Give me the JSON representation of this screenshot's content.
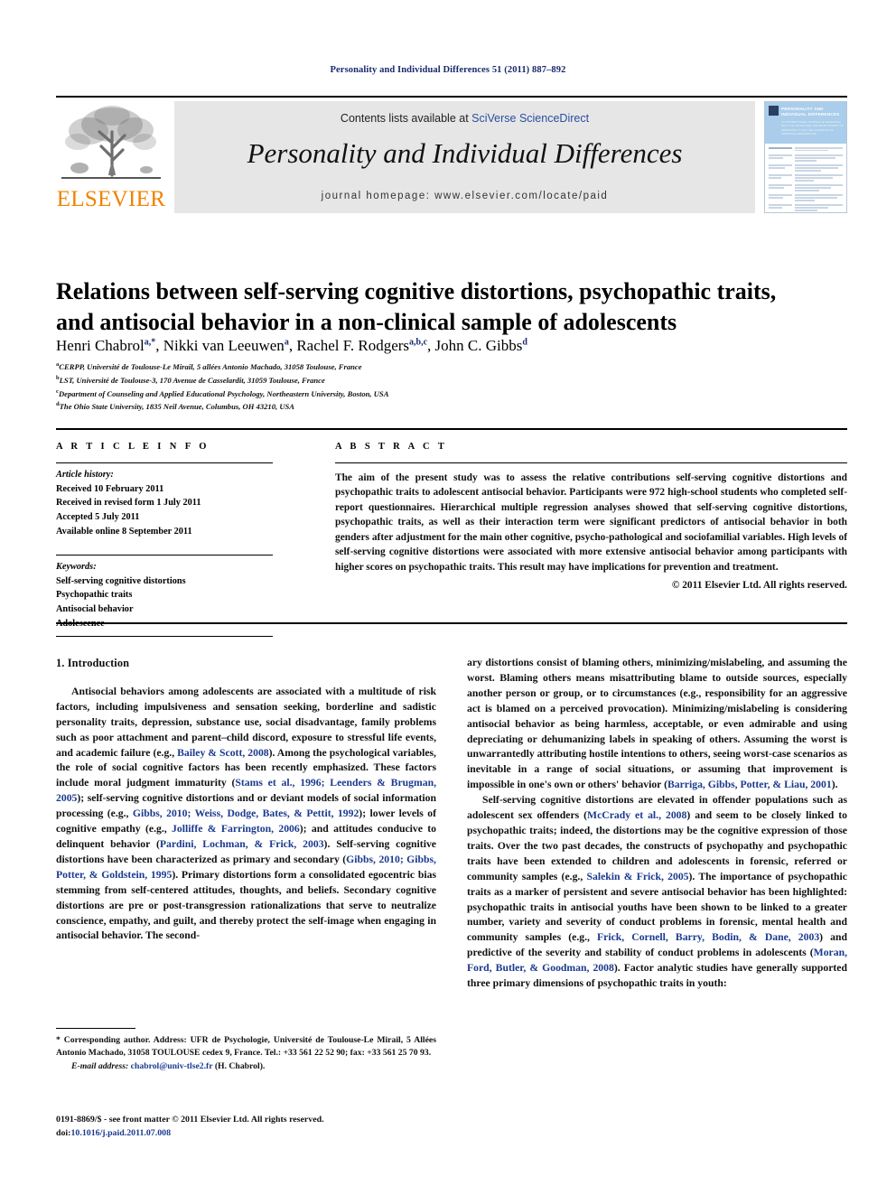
{
  "running_head": "Personality and Individual Differences 51 (2011) 887–892",
  "masthead": {
    "publisher_name": "ELSEVIER",
    "contents_prefix": "Contents lists available at ",
    "contents_link": "SciVerse ScienceDirect",
    "journal_title": "Personality and Individual Differences",
    "homepage": "journal homepage: www.elsevier.com/locate/paid",
    "cover": {
      "title": "PERSONALITY AND INDIVIDUAL DIFFERENCES",
      "subtitle": "AN INTERNATIONAL JOURNAL OF RESEARCH INTO THE STRUCTURE AND DEVELOPMENT OF PERSONALITY AND THE CAUSATION OF INDIVIDUAL DIFFERENCES"
    }
  },
  "article": {
    "title": "Relations between self-serving cognitive distortions, psychopathic traits, and antisocial behavior in a non-clinical sample of adolescents",
    "authors": [
      {
        "name": "Henri Chabrol",
        "sup": "a,*"
      },
      {
        "name": "Nikki van Leeuwen",
        "sup": "a"
      },
      {
        "name": "Rachel F. Rodgers",
        "sup": "a,b,c"
      },
      {
        "name": "John C. Gibbs",
        "sup": "d"
      }
    ],
    "affiliations": [
      {
        "mark": "a",
        "text": "CERPP, Université de Toulouse-Le Mirail, 5 allées Antonio Machado, 31058 Toulouse, France"
      },
      {
        "mark": "b",
        "text": "LST, Université de Toulouse-3, 170 Avenue de Casselardit, 31059 Toulouse, France"
      },
      {
        "mark": "c",
        "text": "Department of Counseling and Applied Educational Psychology, Northeastern University, Boston, USA"
      },
      {
        "mark": "d",
        "text": "The Ohio State University, 1835 Neil Avenue, Columbus, OH 43210, USA"
      }
    ]
  },
  "article_info": {
    "label": "A R T I C L E  I N F O",
    "history_label": "Article history:",
    "history": [
      "Received 10 February 2011",
      "Received in revised form 1 July 2011",
      "Accepted 5 July 2011",
      "Available online 8 September 2011"
    ],
    "keywords_label": "Keywords:",
    "keywords": [
      "Self-serving cognitive distortions",
      "Psychopathic traits",
      "Antisocial behavior",
      "Adolescence"
    ]
  },
  "abstract": {
    "label": "A B S T R A C T",
    "text": "The aim of the present study was to assess the relative contributions self-serving cognitive distortions and psychopathic traits to adolescent antisocial behavior. Participants were 972 high-school students who completed self-report questionnaires. Hierarchical multiple regression analyses showed that self-serving cognitive distortions, psychopathic traits, as well as their interaction term were significant predictors of antisocial behavior in both genders after adjustment for the main other cognitive, psycho-pathological and sociofamilial variables. High levels of self-serving cognitive distortions were associated with more extensive antisocial behavior among participants with higher scores on psychopathic traits. This result may have implications for prevention and treatment.",
    "copyright": "© 2011 Elsevier Ltd. All rights reserved."
  },
  "body": {
    "section_heading": "1. Introduction",
    "left_paragraphs": [
      {
        "parts": [
          {
            "t": "Antisocial behaviors among adolescents are associated with a multitude of risk factors, including impulsiveness and sensation seeking, borderline and sadistic personality traits, depression, substance use, social disadvantage, family problems such as poor attachment and parent–child discord, exposure to stressful life events, and academic failure (e.g., ",
            "ref": false
          },
          {
            "t": "Bailey & Scott, 2008",
            "ref": true
          },
          {
            "t": "). Among the psychological variables, the role of social cognitive factors has been recently emphasized. These factors include moral judgment immaturity (",
            "ref": false
          },
          {
            "t": "Stams et al., 1996; Leenders & Brugman, 2005",
            "ref": true
          },
          {
            "t": "); self-serving cognitive distortions and or deviant models of social information processing (e.g., ",
            "ref": false
          },
          {
            "t": "Gibbs, 2010; Weiss, Dodge, Bates, & Pettit, 1992",
            "ref": true
          },
          {
            "t": "); lower levels of cognitive empathy (e.g., ",
            "ref": false
          },
          {
            "t": "Jolliffe & Farrington, 2006",
            "ref": true
          },
          {
            "t": "); and attitudes conducive to delinquent behavior (",
            "ref": false
          },
          {
            "t": "Pardini, Lochman, & Frick, 2003",
            "ref": true
          },
          {
            "t": "). Self-serving cognitive distortions have been characterized as primary and secondary (",
            "ref": false
          },
          {
            "t": "Gibbs, 2010; Gibbs, Potter, & Goldstein, 1995",
            "ref": true
          },
          {
            "t": "). Primary distortions form a consolidated egocentric bias stemming from self-centered attitudes, thoughts, and beliefs. Secondary cognitive distortions are pre or post-transgression rationalizations that serve to neutralize conscience, empathy, and guilt, and thereby protect the self-image when engaging in antisocial behavior. The second-",
            "ref": false
          }
        ]
      }
    ],
    "right_paragraphs": [
      {
        "noindent": true,
        "parts": [
          {
            "t": "ary distortions consist of blaming others, minimizing/mislabeling, and assuming the worst. Blaming others means misattributing blame to outside sources, especially another person or group, or to circumstances (e.g., responsibility for an aggressive act is blamed on a perceived provocation). Minimizing/mislabeling is considering antisocial behavior as being harmless, acceptable, or even admirable and using depreciating or dehumanizing labels in speaking of others. Assuming the worst is unwarrantedly attributing hostile intentions to others, seeing worst-case scenarios as inevitable in a range of social situations, or assuming that improvement is impossible in one's own or others' behavior (",
            "ref": false
          },
          {
            "t": "Barriga, Gibbs, Potter, & Liau, 2001",
            "ref": true
          },
          {
            "t": ").",
            "ref": false
          }
        ]
      },
      {
        "noindent": false,
        "parts": [
          {
            "t": "Self-serving cognitive distortions are elevated in offender populations such as adolescent sex offenders (",
            "ref": false
          },
          {
            "t": "McCrady et al., 2008",
            "ref": true
          },
          {
            "t": ") and seem to be closely linked to psychopathic traits; indeed, the distortions may be the cognitive expression of those traits. Over the two past decades, the constructs of psychopathy and psychopathic traits have been extended to children and adolescents in forensic, referred or community samples (e.g., ",
            "ref": false
          },
          {
            "t": "Salekin & Frick, 2005",
            "ref": true
          },
          {
            "t": "). The importance of psychopathic traits as a marker of persistent and severe antisocial behavior has been highlighted: psychopathic traits in antisocial youths have been shown to be linked to a greater number, variety and severity of conduct problems in forensic, mental health and community samples (e.g., ",
            "ref": false
          },
          {
            "t": "Frick, Cornell, Barry, Bodin, & Dane, 2003",
            "ref": true
          },
          {
            "t": ") and predictive of the severity and stability of conduct problems in adolescents (",
            "ref": false
          },
          {
            "t": "Moran, Ford, Butler, & Goodman, 2008",
            "ref": true
          },
          {
            "t": "). Factor analytic studies have generally supported three primary dimensions of psychopathic traits in youth:",
            "ref": false
          }
        ]
      }
    ]
  },
  "footnote": {
    "corresponding": "* Corresponding author. Address: UFR de Psychologie, Université de Toulouse-Le Mirail, 5 Allées Antonio Machado, 31058 TOULOUSE cedex 9, France. Tel.: +33 561 22 52 90; fax: +33 561 25 70 93.",
    "email_label": "E-mail address:",
    "email": "chabrol@univ-tlse2.fr",
    "email_owner": "(H. Chabrol)."
  },
  "footer": {
    "issn_line": "0191-8869/$ - see front matter © 2011 Elsevier Ltd. All rights reserved.",
    "doi_label": "doi:",
    "doi": "10.1016/j.paid.2011.07.008"
  },
  "colors": {
    "link": "#2b4ea2",
    "reference": "#1a3a8f",
    "elsevier_orange": "#f08200",
    "band_gray": "#e6e6e6",
    "cover_blue": "#a9cdea"
  }
}
